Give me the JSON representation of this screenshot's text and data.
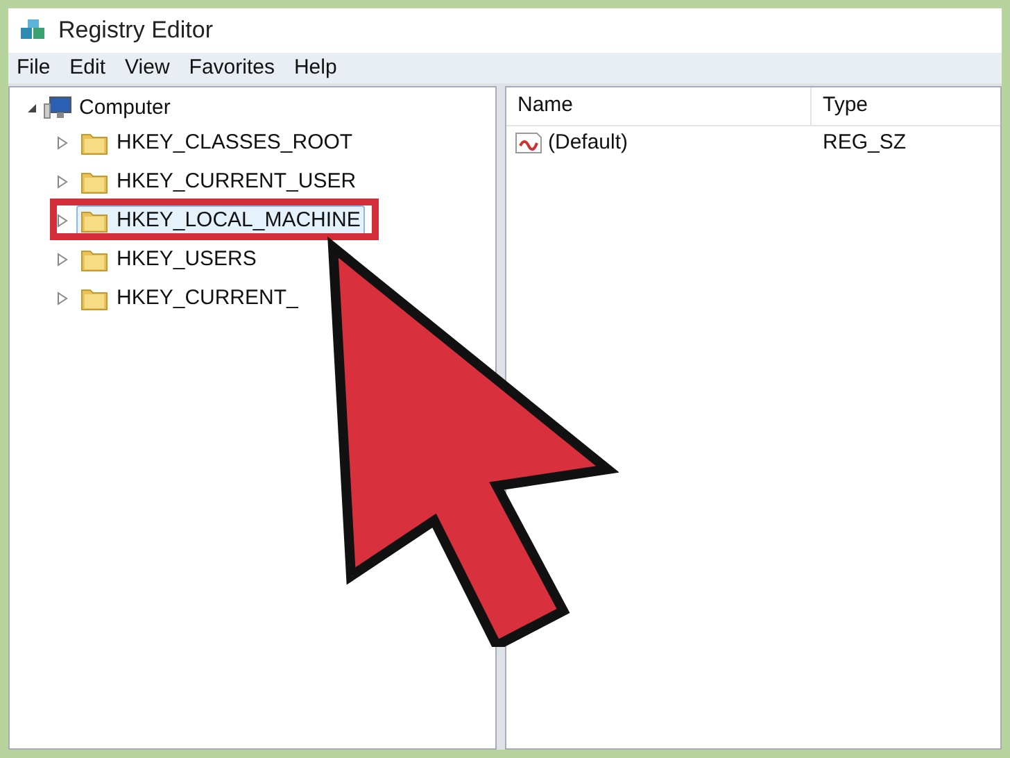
{
  "window": {
    "title": "Registry Editor"
  },
  "menu": [
    "File",
    "Edit",
    "View",
    "Favorites",
    "Help"
  ],
  "tree": {
    "label": "Computer",
    "expanded": true,
    "children": [
      {
        "label": "HKEY_CLASSES_ROOT",
        "selected": false
      },
      {
        "label": "HKEY_CURRENT_USER",
        "selected": false
      },
      {
        "label": "HKEY_LOCAL_MACHINE",
        "selected": true
      },
      {
        "label": "HKEY_USERS",
        "selected": false
      },
      {
        "label": "HKEY_CURRENT_",
        "selected": false
      }
    ]
  },
  "table": {
    "columns": [
      "Name",
      "Type"
    ],
    "rows": [
      {
        "name": "(Default)",
        "type": "REG_SZ"
      }
    ]
  }
}
